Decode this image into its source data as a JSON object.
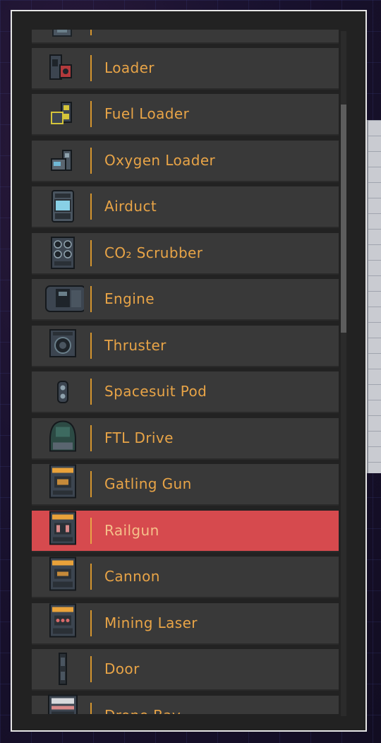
{
  "items": [
    {
      "label": "",
      "icon": "partial-module-icon"
    },
    {
      "label": "Loader",
      "icon": "loader-icon"
    },
    {
      "label": "Fuel Loader",
      "icon": "fuel-loader-icon"
    },
    {
      "label": "Oxygen Loader",
      "icon": "oxygen-loader-icon"
    },
    {
      "label": "Airduct",
      "icon": "airduct-icon"
    },
    {
      "label": "CO₂ Scrubber",
      "icon": "co2-scrubber-icon"
    },
    {
      "label": "Engine",
      "icon": "engine-icon"
    },
    {
      "label": "Thruster",
      "icon": "thruster-icon"
    },
    {
      "label": "Spacesuit Pod",
      "icon": "spacesuit-pod-icon"
    },
    {
      "label": "FTL Drive",
      "icon": "ftl-drive-icon"
    },
    {
      "label": "Gatling Gun",
      "icon": "gatling-gun-icon"
    },
    {
      "label": "Railgun",
      "icon": "railgun-icon",
      "selected": true
    },
    {
      "label": "Cannon",
      "icon": "cannon-icon"
    },
    {
      "label": "Mining Laser",
      "icon": "mining-laser-icon"
    },
    {
      "label": "Door",
      "icon": "door-icon"
    },
    {
      "label": "Drone Bay",
      "icon": "drone-bay-icon"
    }
  ],
  "colors": {
    "row_bg": "#393939",
    "selected_bg": "#d64a4e",
    "label_text": "#e8a447",
    "divider": "#d5952e",
    "panel_border": "#e6e6e6"
  },
  "scroll": {
    "position": 0.11
  }
}
